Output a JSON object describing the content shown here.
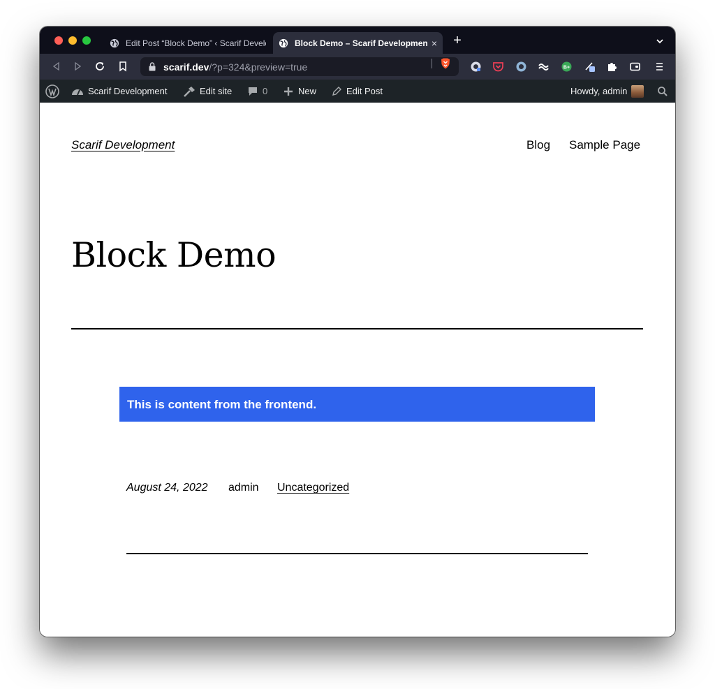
{
  "browser": {
    "tabs": [
      {
        "title": "Edit Post “Block Demo” ‹ Scarif Development",
        "active": false
      },
      {
        "title": "Block Demo – Scarif Development",
        "active": true,
        "close": "×"
      }
    ],
    "new_tab": "+",
    "url": {
      "host": "scarif.dev",
      "path": "/?p=324&preview=true"
    },
    "colors": {
      "tab_strip": "#0e0f1a",
      "toolbar": "#2c2e3c",
      "brave": "#fb542b"
    }
  },
  "admin_bar": {
    "site_name": "Scarif Development",
    "edit_site": "Edit site",
    "comments_count": "0",
    "new_label": "New",
    "edit_post": "Edit Post",
    "greeting": "Howdy, admin",
    "color": "#1d2327"
  },
  "site": {
    "title": "Scarif Development",
    "nav": [
      "Blog",
      "Sample Page"
    ]
  },
  "post": {
    "title": "Block Demo",
    "banner_text": "This is content from the frontend.",
    "banner_color": "#2f63ec",
    "date": "August 24, 2022",
    "author": "admin",
    "category": "Uncategorized"
  }
}
